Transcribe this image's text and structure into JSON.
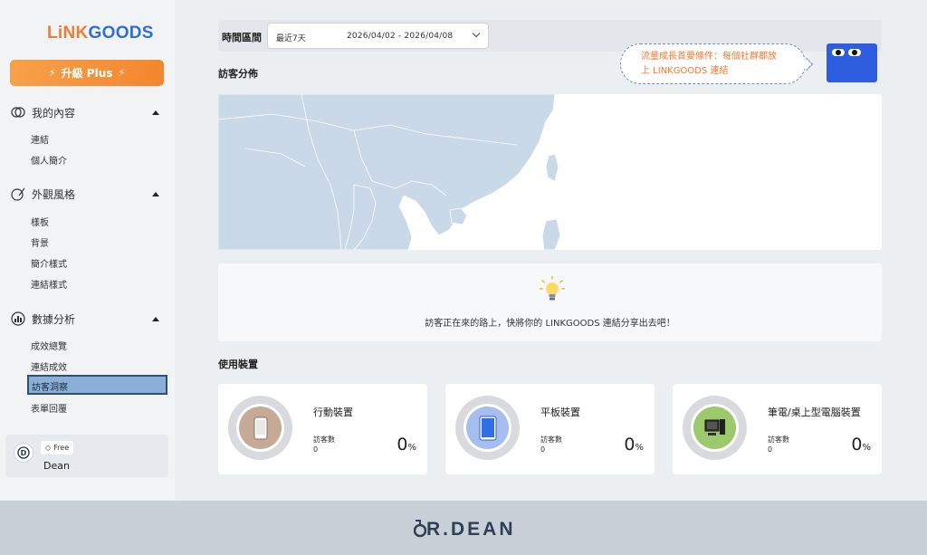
{
  "sidebar": {
    "logo": {
      "part1": "LiNK",
      "part2": "GOODS"
    },
    "upgrade": {
      "label": "升級 Plus"
    },
    "groups": [
      {
        "label": "我的內容",
        "items": [
          "連結",
          "個人簡介"
        ]
      },
      {
        "label": "外觀風格",
        "items": [
          "樣板",
          "背景",
          "簡介樣式",
          "連結樣式"
        ]
      },
      {
        "label": "數據分析",
        "items": [
          "成效總覽",
          "連結成效",
          "訪客洞察",
          "表單回覆"
        ]
      }
    ],
    "active_item": "訪客洞察",
    "user": {
      "plan": "Free",
      "name": "Dean"
    }
  },
  "filter": {
    "label": "時間區間",
    "range_name": "最近7天",
    "range_dates": "2026/04/02 - 2026/04/08"
  },
  "tip": {
    "text_line1": "流量成長首要條件：每個社群都放",
    "text_line2": "上 LINKGOODS 連結"
  },
  "sections": {
    "visitor_distribution": "訪客分佈",
    "devices": "使用裝置"
  },
  "empty_message": "訪客正在來的路上，快將你的 LINKGOODS 連結分享出去吧！",
  "devices": [
    {
      "name": "行動裝置",
      "visitors_label": "訪客數",
      "visitors": "0",
      "percent": "0",
      "unit": "%",
      "disc_color": "#c5ab97",
      "icon": "phone-icon"
    },
    {
      "name": "平板裝置",
      "visitors_label": "訪客數",
      "visitors": "0",
      "percent": "0",
      "unit": "%",
      "disc_color": "#a6bdf0",
      "icon": "tablet-icon"
    },
    {
      "name": "筆電/桌上型電腦裝置",
      "visitors_label": "訪客數",
      "visitors": "0",
      "percent": "0",
      "unit": "%",
      "disc_color": "#9cc96b",
      "icon": "desktop-icon"
    }
  ],
  "footer": {
    "brand": "R.DEAN"
  },
  "colors": {
    "accent": "#f3862f",
    "brand_blue": "#2d6fd8",
    "map_land": "#c9d9e8",
    "active_nav": "#8aafd8"
  }
}
